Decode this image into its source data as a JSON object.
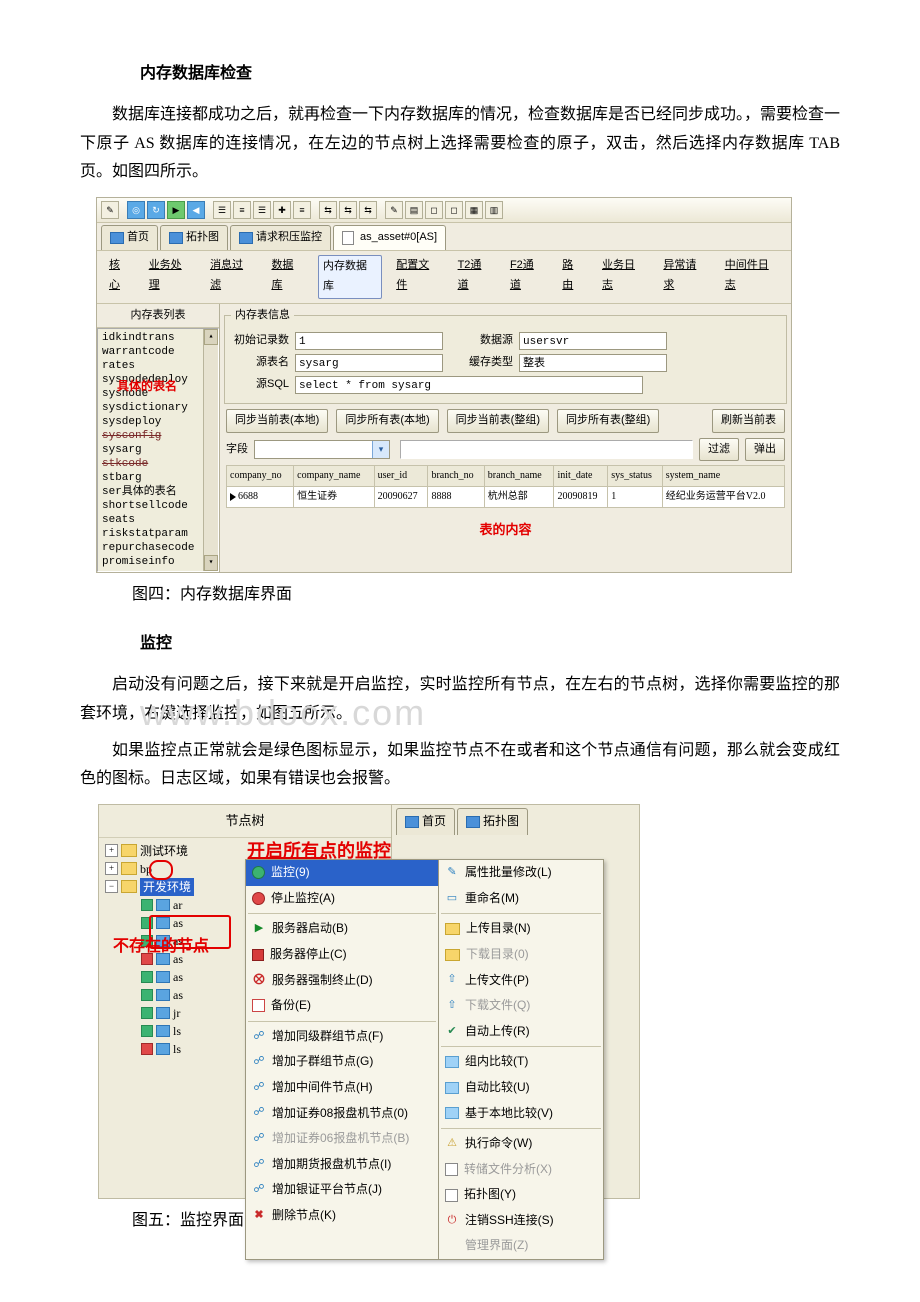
{
  "sections": {
    "s1_title": "内存数据库检查",
    "s1_p1": "数据库连接都成功之后，就再检查一下内存数据库的情况，检查数据库是否已经同步成功。，需要检查一下原子 AS 数据库的连接情况，在左边的节点树上选择需要检查的原子，双击，然后选择内存数据库 TAB 页。如图四所示。",
    "fig4_caption": "图四：内存数据库界面",
    "s2_title": "监控",
    "s2_p1": "启动没有问题之后，接下来就是开启监控，实时监控所有节点，在左右的节点树，选择你需要监控的那套环境，右键选择监控，如图五所示。",
    "s2_p2": "如果监控点正常就会是绿色图标显示，如果监控节点不在或者和这个节点通信有问题，那么就会变成红色的图标。日志区域，如果有错误也会报警。",
    "fig5_caption": "图五：监控界面",
    "watermark": "www.bdocx.com"
  },
  "fig4": {
    "upper_tabs": [
      "首页",
      "拓扑图",
      "请求积压监控",
      "as_asset#0[AS]"
    ],
    "sub_tabs": [
      "核心",
      "业务处理",
      "消息过滤",
      "数据库",
      "内存数据库",
      "配置文件",
      "T2通道",
      "F2通道",
      "路由",
      "业务日志",
      "异常请求",
      "中间件日志"
    ],
    "sub_tab_selected": "内存数据库",
    "left_header": "内存表列表",
    "left_items": [
      "idkindtrans",
      "warrantcode",
      "rates",
      "sysnodedeploy",
      "sysnode",
      "sysdictionary",
      "sysdeploy",
      "sysconfig",
      "sysarg",
      "stkcode",
      "stbarg",
      "ser具体的表名",
      "shortsellcode",
      "seats",
      "riskstatparam",
      "repurchasecode",
      "promiseinfo"
    ],
    "left_strikes": [
      "sysconfig",
      "stkcode"
    ],
    "left_red_overlay": "具体的表名",
    "group_legend": "内存表信息",
    "rows": {
      "init_label": "初始记录数",
      "init_val": "1",
      "ds_label": "数据源",
      "ds_val": "usersvr",
      "srctab_label": "源表名",
      "srctab_val": "sysarg",
      "cache_label": "缓存类型",
      "cache_val": "整表",
      "srcsql_label": "源SQL",
      "srcsql_val": "select * from sysarg"
    },
    "buttons": [
      "同步当前表(本地)",
      "同步所有表(本地)",
      "同步当前表(整组)",
      "同步所有表(整组)",
      "刷新当前表"
    ],
    "field_label": "字段",
    "right_buttons": [
      "过滤",
      "弹出"
    ],
    "table_headers": [
      "company_no",
      "company_name",
      "user_id",
      "branch_no",
      "branch_name",
      "init_date",
      "sys_status",
      "system_name"
    ],
    "table_row": [
      "6688",
      "恒生证券",
      "20090627",
      "8888",
      "杭州总部",
      "20090819",
      "1",
      "经纪业务运营平台V2.0"
    ],
    "table_content_label": "表的内容"
  },
  "fig5": {
    "tree_header": "节点树",
    "right_tabs": [
      "首页",
      "拓扑图"
    ],
    "root1": "测试环境",
    "root2": "bp",
    "root3": "开发环境",
    "leaves": [
      "ar",
      "as",
      "as",
      "as",
      "as",
      "as",
      "jr",
      "ls",
      "ls"
    ],
    "red_label_top": "开启所有点的监控",
    "red_label_left": "不存在的节点",
    "menu_left": [
      {
        "t": "监控(9)",
        "i": "gball",
        "sel": true
      },
      {
        "t": "停止监控(A)",
        "i": "rball"
      },
      {
        "sep": true
      },
      {
        "t": "服务器启动(B)",
        "i": "play"
      },
      {
        "t": "服务器停止(C)",
        "i": "stopR"
      },
      {
        "t": "服务器强制终止(D)",
        "i": "stopBig"
      },
      {
        "t": "备份(E)",
        "i": "backup"
      },
      {
        "sep": true
      },
      {
        "t": "增加同级群组节点(F)",
        "i": "addnode"
      },
      {
        "t": "增加子群组节点(G)",
        "i": "addnode"
      },
      {
        "t": "增加中间件节点(H)",
        "i": "addnode"
      },
      {
        "t": "增加证券08报盘机节点(0)",
        "i": "addnode"
      },
      {
        "t": "增加证券06报盘机节点(B)",
        "i": "addnode",
        "dis": true
      },
      {
        "t": "增加期货报盘机节点(I)",
        "i": "addnode"
      },
      {
        "t": "增加银证平台节点(J)",
        "i": "addnode"
      },
      {
        "t": "删除节点(K)",
        "i": "del"
      }
    ],
    "menu_right": [
      {
        "t": "属性批量修改(L)",
        "i": "edit"
      },
      {
        "t": "重命名(M)",
        "i": "rename"
      },
      {
        "sep": true
      },
      {
        "t": "上传目录(N)",
        "i": "folder"
      },
      {
        "t": "下载目录(0)",
        "i": "folder",
        "dis": true
      },
      {
        "t": "上传文件(P)",
        "i": "up"
      },
      {
        "t": "下载文件(Q)",
        "i": "up",
        "dis": true
      },
      {
        "t": "自动上传(R)",
        "i": "auto"
      },
      {
        "sep": true
      },
      {
        "t": "组内比较(T)",
        "i": "cmp"
      },
      {
        "t": "自动比较(U)",
        "i": "cmp"
      },
      {
        "t": "基于本地比较(V)",
        "i": "cmp"
      },
      {
        "sep": true
      },
      {
        "t": "执行命令(W)",
        "i": "exec"
      },
      {
        "t": "转储文件分析(X)",
        "i": "topo",
        "dis": true
      },
      {
        "t": "拓扑图(Y)",
        "i": "topo"
      },
      {
        "t": "注销SSH连接(S)",
        "i": "logout"
      },
      {
        "t": "管理界面(Z)",
        "dis": true
      }
    ]
  }
}
